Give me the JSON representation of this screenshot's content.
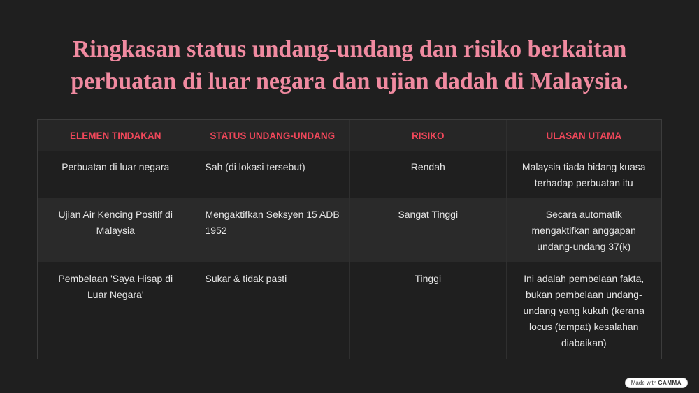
{
  "title": "Ringkasan status undang-undang dan risiko berkaitan perbuatan di luar negara dan ujian dadah di Malaysia.",
  "table": {
    "headers": [
      "ELEMEN TINDAKAN",
      "STATUS UNDANG-UNDANG",
      "RISIKO",
      "ULASAN UTAMA"
    ],
    "rows": [
      [
        "Perbuatan di luar negara",
        "Sah (di lokasi tersebut)",
        "Rendah",
        "Malaysia tiada bidang kuasa terhadap perbuatan itu"
      ],
      [
        "Ujian Air Kencing Positif di Malaysia",
        "Mengaktifkan Seksyen 15 ADB 1952",
        "Sangat Tinggi",
        "Secara automatik mengaktifkan anggapan undang-undang 37(k)"
      ],
      [
        "Pembelaan 'Saya Hisap di Luar Negara'",
        "Sukar & tidak pasti",
        "Tinggi",
        "Ini adalah pembelaan fakta, bukan pembelaan undang-undang yang kukuh (kerana locus (tempat) kesalahan diabaikan)"
      ]
    ]
  },
  "badge": {
    "prefix": "Made with",
    "brand": "GAMMA"
  },
  "colors": {
    "title": "#f08aa0",
    "header_text": "#f0475a",
    "background": "#1f1f1f"
  }
}
